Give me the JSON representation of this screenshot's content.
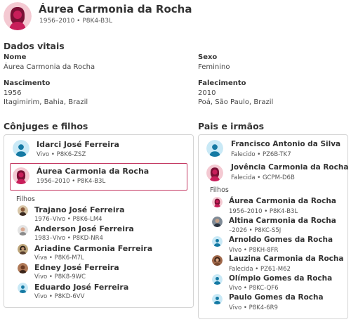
{
  "header": {
    "name": "Áurea Carmonia da Rocha",
    "meta": "1956–2010 • P8K4-B3L"
  },
  "vitals": {
    "title": "Dados vitais",
    "name_label": "Nome",
    "name_value": "Áurea Carmonia da Rocha",
    "sex_label": "Sexo",
    "sex_value": "Feminino",
    "birth_label": "Nascimento",
    "birth_date": "1956",
    "birth_place": "Itagimirim, Bahia, Brazil",
    "death_label": "Falecimento",
    "death_date": "2010",
    "death_place": "Poá, São Paulo, Brazil"
  },
  "spouses": {
    "title": "Cônjuges e filhos",
    "spouse": {
      "name": "Idarci José Ferreira",
      "meta": "Vivo • P8K6-ZSZ"
    },
    "self": {
      "name": "Áurea Carmonia da Rocha",
      "meta": "1956–2010 • P8K4-B3L"
    },
    "children_label": "Filhos",
    "children": [
      {
        "name": "Trajano José Ferreira",
        "meta": "1976–Vivo • P8K6-LM4"
      },
      {
        "name": "Anderson José Ferreira",
        "meta": "1983–Vivo • P8KD-NR4"
      },
      {
        "name": "Ariadine Carmonia Ferreira",
        "meta": "Viva • P8K6-M7L"
      },
      {
        "name": "Edney José Ferreira",
        "meta": "Vivo • P8K8-9WC"
      },
      {
        "name": "Eduardo José Ferreira",
        "meta": "Vivo • P8KD-6VV"
      }
    ]
  },
  "parents": {
    "title": "Pais e irmãos",
    "father": {
      "name": "Francisco Antonio da Silva",
      "meta": "Falecido • PZ6B-TK7"
    },
    "mother": {
      "name": "Jovência Carmonia da Rocha",
      "meta": "Falecida • GCPM-D6B"
    },
    "children_label": "Filhos",
    "siblings": [
      {
        "name": "Áurea Carmonia da Rocha",
        "meta": "1956–2010 • P8K4-B3L"
      },
      {
        "name": "Altina Carmonia da Rocha",
        "meta": "–2026 • P8KC-S5J"
      },
      {
        "name": "Arnoldo Gomes da Rocha",
        "meta": "Vivo • P8KH-8FR"
      },
      {
        "name": "Lauzina Carmonia da Rocha",
        "meta": "Falecida • PZ61-M62"
      },
      {
        "name": "Olímpio Gomes da Rocha",
        "meta": "Vivo • P8KC-QF6"
      },
      {
        "name": "Paulo Gomes da Rocha",
        "meta": "Vivo • P8K4-6R9"
      }
    ]
  },
  "colors": {
    "female_avatar": "#f4c9d2",
    "female_figure": "#c81e5a",
    "male_avatar": "#c9e9f6",
    "male_figure": "#1479a3",
    "selected_border": "#c43a63"
  }
}
